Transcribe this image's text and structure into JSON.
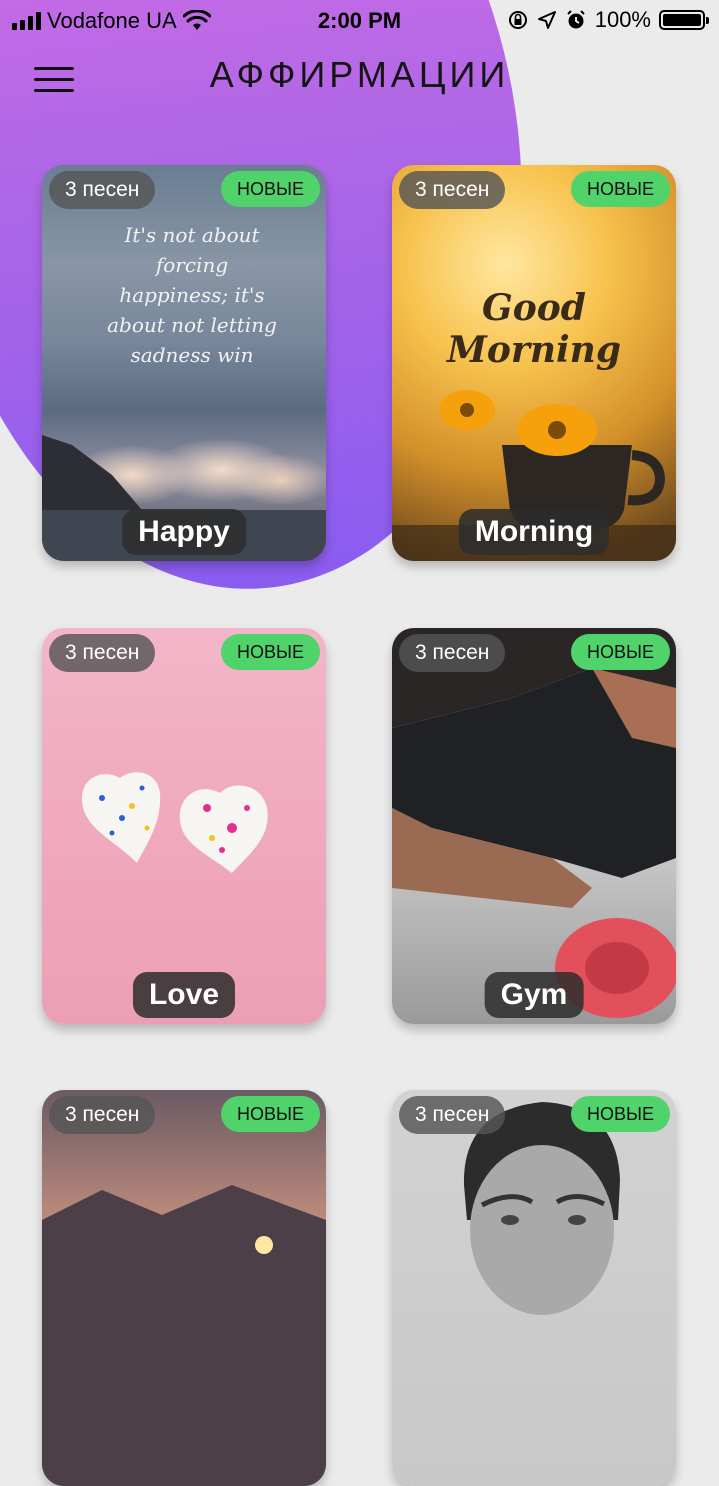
{
  "status_bar": {
    "carrier": "Vodafone UA",
    "time": "2:00 PM",
    "battery": "100%"
  },
  "header": {
    "title": "АФФИРМАЦИИ"
  },
  "card_quote": "It's not about forcing happiness; it's about not letting sadness win",
  "card_greeting": "Good Morning",
  "cards": [
    {
      "count": "3 песен",
      "badge": "НОВЫЕ",
      "label": "Happy"
    },
    {
      "count": "3 песен",
      "badge": "НОВЫЕ",
      "label": "Morning"
    },
    {
      "count": "3 песен",
      "badge": "НОВЫЕ",
      "label": "Love"
    },
    {
      "count": "3 песен",
      "badge": "НОВЫЕ",
      "label": "Gym"
    },
    {
      "count": "3 песен",
      "badge": "НОВЫЕ",
      "label": ""
    },
    {
      "count": "3 песен",
      "badge": "НОВЫЕ",
      "label": ""
    }
  ],
  "colors": {
    "accent_gradient_top": "#e06ee6",
    "accent_gradient_bottom": "#8a5cf0",
    "new_badge": "#4fd36a"
  }
}
